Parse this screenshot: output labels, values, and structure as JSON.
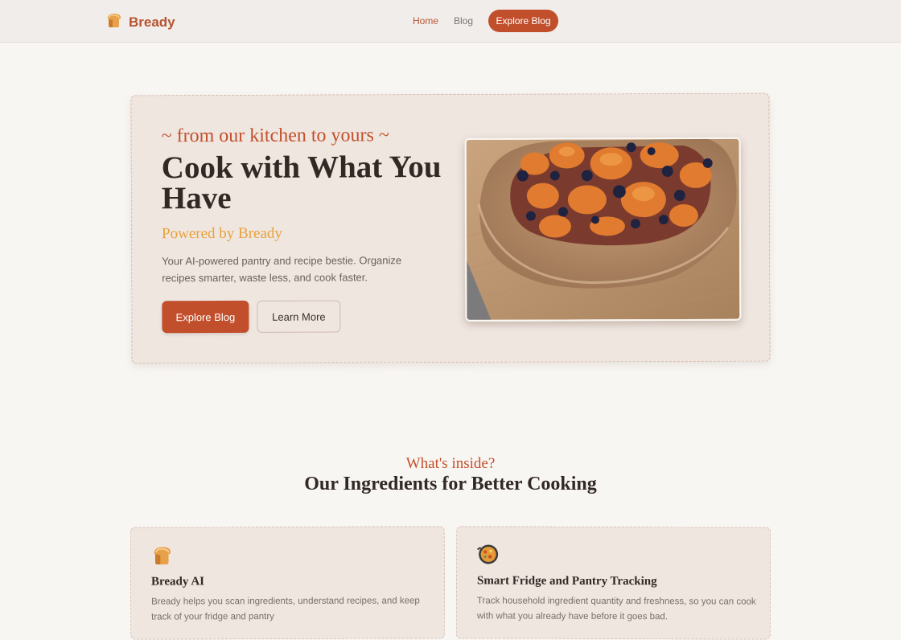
{
  "nav": {
    "brand": "Bready",
    "brand_icon": "bread-icon",
    "links": [
      "Home",
      "Blog"
    ],
    "cta": "Explore Blog"
  },
  "hero": {
    "tagline": "~ from our kitchen to yours ~",
    "title": "Cook with What You Have",
    "subtitle": "Powered by Bready",
    "description": "Your AI-powered pantry and recipe bestie. Organize recipes smarter, waste less, and cook faster.",
    "primary_button": "Explore Blog",
    "secondary_button": "Learn More",
    "image": "galette-photo"
  },
  "section": {
    "eyebrow": "What's inside?",
    "title": "Our Ingredients for Better Cooking"
  },
  "cards": [
    {
      "icon": "bread-icon",
      "title": "Bready AI",
      "description": "Bready helps you scan ingredients, understand recipes, and keep track of your fridge and pantry"
    },
    {
      "icon": "paella-pan-icon",
      "title": "Smart Fridge and Pantry Tracking",
      "description": "Track household ingredient quantity and freshness, so you can cook with what you already have before it goes bad."
    }
  ],
  "colors": {
    "accent": "#c24f2b",
    "gold": "#e6a23c",
    "card_bg": "#efe6e0",
    "page_bg": "#f8f6f3"
  }
}
